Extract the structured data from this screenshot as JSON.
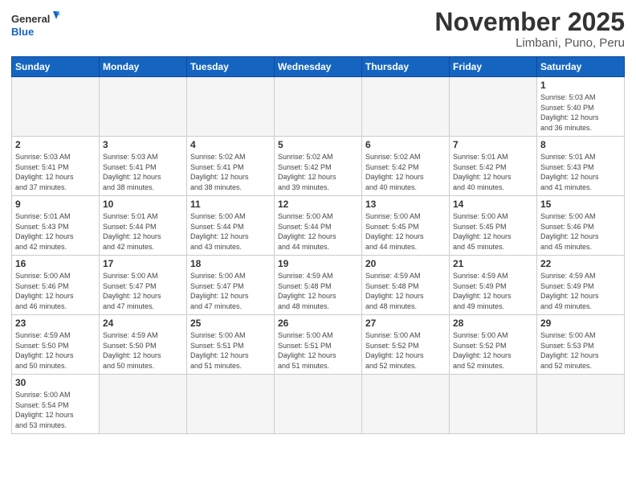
{
  "logo": {
    "text_general": "General",
    "text_blue": "Blue"
  },
  "header": {
    "month_year": "November 2025",
    "location": "Limbani, Puno, Peru"
  },
  "weekdays": [
    "Sunday",
    "Monday",
    "Tuesday",
    "Wednesday",
    "Thursday",
    "Friday",
    "Saturday"
  ],
  "weeks": [
    [
      {
        "day": "",
        "info": ""
      },
      {
        "day": "",
        "info": ""
      },
      {
        "day": "",
        "info": ""
      },
      {
        "day": "",
        "info": ""
      },
      {
        "day": "",
        "info": ""
      },
      {
        "day": "",
        "info": ""
      },
      {
        "day": "1",
        "info": "Sunrise: 5:03 AM\nSunset: 5:40 PM\nDaylight: 12 hours\nand 36 minutes."
      }
    ],
    [
      {
        "day": "2",
        "info": "Sunrise: 5:03 AM\nSunset: 5:41 PM\nDaylight: 12 hours\nand 37 minutes."
      },
      {
        "day": "3",
        "info": "Sunrise: 5:03 AM\nSunset: 5:41 PM\nDaylight: 12 hours\nand 38 minutes."
      },
      {
        "day": "4",
        "info": "Sunrise: 5:02 AM\nSunset: 5:41 PM\nDaylight: 12 hours\nand 38 minutes."
      },
      {
        "day": "5",
        "info": "Sunrise: 5:02 AM\nSunset: 5:42 PM\nDaylight: 12 hours\nand 39 minutes."
      },
      {
        "day": "6",
        "info": "Sunrise: 5:02 AM\nSunset: 5:42 PM\nDaylight: 12 hours\nand 40 minutes."
      },
      {
        "day": "7",
        "info": "Sunrise: 5:01 AM\nSunset: 5:42 PM\nDaylight: 12 hours\nand 40 minutes."
      },
      {
        "day": "8",
        "info": "Sunrise: 5:01 AM\nSunset: 5:43 PM\nDaylight: 12 hours\nand 41 minutes."
      }
    ],
    [
      {
        "day": "9",
        "info": "Sunrise: 5:01 AM\nSunset: 5:43 PM\nDaylight: 12 hours\nand 42 minutes."
      },
      {
        "day": "10",
        "info": "Sunrise: 5:01 AM\nSunset: 5:44 PM\nDaylight: 12 hours\nand 42 minutes."
      },
      {
        "day": "11",
        "info": "Sunrise: 5:00 AM\nSunset: 5:44 PM\nDaylight: 12 hours\nand 43 minutes."
      },
      {
        "day": "12",
        "info": "Sunrise: 5:00 AM\nSunset: 5:44 PM\nDaylight: 12 hours\nand 44 minutes."
      },
      {
        "day": "13",
        "info": "Sunrise: 5:00 AM\nSunset: 5:45 PM\nDaylight: 12 hours\nand 44 minutes."
      },
      {
        "day": "14",
        "info": "Sunrise: 5:00 AM\nSunset: 5:45 PM\nDaylight: 12 hours\nand 45 minutes."
      },
      {
        "day": "15",
        "info": "Sunrise: 5:00 AM\nSunset: 5:46 PM\nDaylight: 12 hours\nand 45 minutes."
      }
    ],
    [
      {
        "day": "16",
        "info": "Sunrise: 5:00 AM\nSunset: 5:46 PM\nDaylight: 12 hours\nand 46 minutes."
      },
      {
        "day": "17",
        "info": "Sunrise: 5:00 AM\nSunset: 5:47 PM\nDaylight: 12 hours\nand 47 minutes."
      },
      {
        "day": "18",
        "info": "Sunrise: 5:00 AM\nSunset: 5:47 PM\nDaylight: 12 hours\nand 47 minutes."
      },
      {
        "day": "19",
        "info": "Sunrise: 4:59 AM\nSunset: 5:48 PM\nDaylight: 12 hours\nand 48 minutes."
      },
      {
        "day": "20",
        "info": "Sunrise: 4:59 AM\nSunset: 5:48 PM\nDaylight: 12 hours\nand 48 minutes."
      },
      {
        "day": "21",
        "info": "Sunrise: 4:59 AM\nSunset: 5:49 PM\nDaylight: 12 hours\nand 49 minutes."
      },
      {
        "day": "22",
        "info": "Sunrise: 4:59 AM\nSunset: 5:49 PM\nDaylight: 12 hours\nand 49 minutes."
      }
    ],
    [
      {
        "day": "23",
        "info": "Sunrise: 4:59 AM\nSunset: 5:50 PM\nDaylight: 12 hours\nand 50 minutes."
      },
      {
        "day": "24",
        "info": "Sunrise: 4:59 AM\nSunset: 5:50 PM\nDaylight: 12 hours\nand 50 minutes."
      },
      {
        "day": "25",
        "info": "Sunrise: 5:00 AM\nSunset: 5:51 PM\nDaylight: 12 hours\nand 51 minutes."
      },
      {
        "day": "26",
        "info": "Sunrise: 5:00 AM\nSunset: 5:51 PM\nDaylight: 12 hours\nand 51 minutes."
      },
      {
        "day": "27",
        "info": "Sunrise: 5:00 AM\nSunset: 5:52 PM\nDaylight: 12 hours\nand 52 minutes."
      },
      {
        "day": "28",
        "info": "Sunrise: 5:00 AM\nSunset: 5:52 PM\nDaylight: 12 hours\nand 52 minutes."
      },
      {
        "day": "29",
        "info": "Sunrise: 5:00 AM\nSunset: 5:53 PM\nDaylight: 12 hours\nand 52 minutes."
      }
    ],
    [
      {
        "day": "30",
        "info": "Sunrise: 5:00 AM\nSunset: 5:54 PM\nDaylight: 12 hours\nand 53 minutes."
      },
      {
        "day": "",
        "info": ""
      },
      {
        "day": "",
        "info": ""
      },
      {
        "day": "",
        "info": ""
      },
      {
        "day": "",
        "info": ""
      },
      {
        "day": "",
        "info": ""
      },
      {
        "day": "",
        "info": ""
      }
    ]
  ]
}
